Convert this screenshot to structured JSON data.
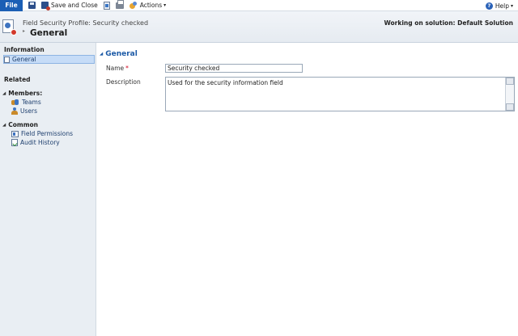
{
  "ribbon": {
    "file_label": "File",
    "save_and_close_label": "Save and Close",
    "actions_label": "Actions",
    "help_label": "Help"
  },
  "header": {
    "entity_name": "Field Security Profile: Security checked",
    "form_title": "General",
    "solution_text": "Working on solution: Default Solution"
  },
  "nav": {
    "information_title": "Information",
    "general_item": "General",
    "related_title": "Related",
    "members_group": "Members:",
    "members_items": [
      "Teams",
      "Users"
    ],
    "common_group": "Common",
    "common_items": [
      "Field Permissions",
      "Audit History"
    ]
  },
  "form": {
    "section_title": "General",
    "name_label": "Name",
    "required_marker": "*",
    "name_value": "Security checked",
    "description_label": "Description",
    "description_value": "Used for the security information field"
  },
  "colors": {
    "file_button": "#1b5fb5",
    "section_title": "#1c5aa6",
    "nav_background": "#e9eef3",
    "nav_selected": "#c6dcf7",
    "required": "#d0021b"
  },
  "icons": [
    "save-icon",
    "save-and-close-icon",
    "document-icon",
    "print-icon",
    "actions-icon",
    "help-icon",
    "field-security-profile-icon",
    "teams-icon",
    "users-icon",
    "field-permissions-icon",
    "audit-history-icon"
  ]
}
